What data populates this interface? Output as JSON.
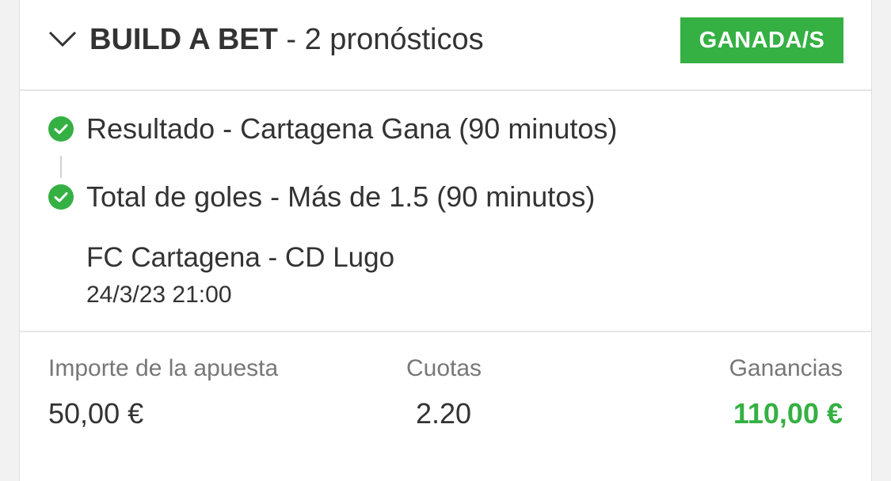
{
  "header": {
    "title_bold": "BUILD A BET",
    "title_rest": " - 2 pronósticos",
    "status_badge": "GANADA/S",
    "chevron_icon": "chevron-down-icon"
  },
  "selections": [
    {
      "label": "Resultado - Cartagena Gana (90 minutos)",
      "icon": "check-circle-icon"
    },
    {
      "label": "Total de goles - Más de 1.5 (90 minutos)",
      "icon": "check-circle-icon"
    }
  ],
  "event": {
    "match": "FC Cartagena - CD Lugo",
    "datetime": "24/3/23 21:00"
  },
  "summary": {
    "stake_label": "Importe de la apuesta",
    "stake_value": "50,00 €",
    "odds_label": "Cuotas",
    "odds_value": "2.20",
    "winnings_label": "Ganancias",
    "winnings_value": "110,00 €"
  },
  "colors": {
    "win_green": "#35b043",
    "text": "#333333",
    "muted": "#777777"
  }
}
